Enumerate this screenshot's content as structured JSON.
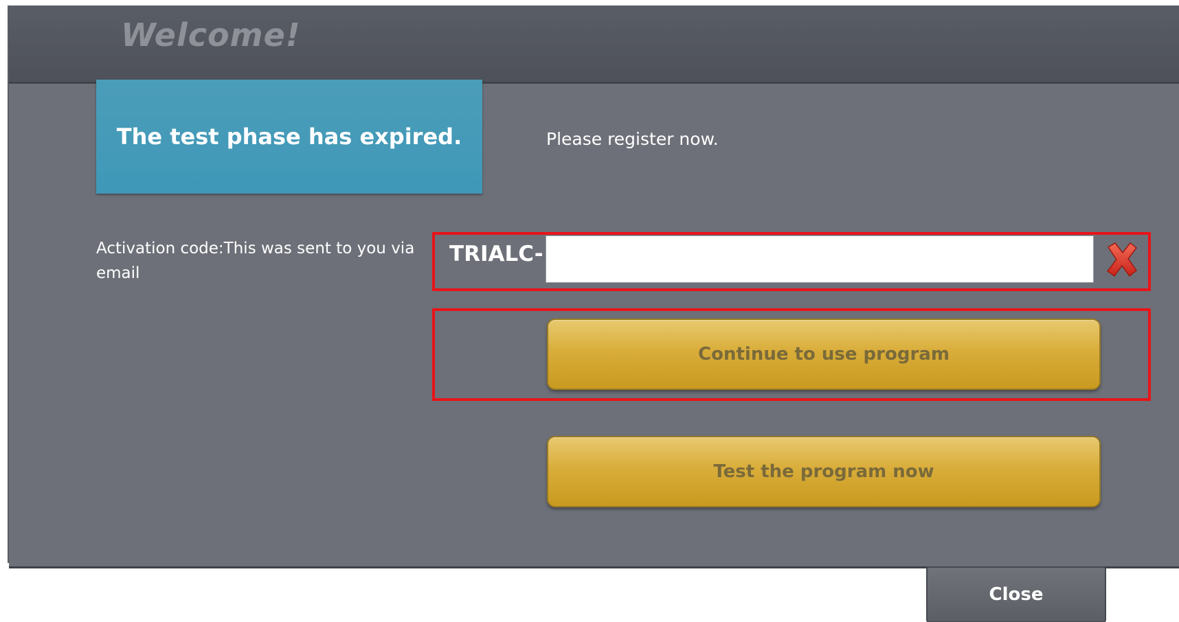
{
  "header": {
    "title": "Welcome!"
  },
  "status": {
    "expired_message": "The test phase has expired.",
    "register_prompt": "Please register now."
  },
  "activation": {
    "label": "Activation code:This was sent to you via email",
    "prefix": "TRIALC-",
    "value": "",
    "placeholder": ""
  },
  "buttons": {
    "continue_label": "Continue to use program",
    "test_label": "Test the program now",
    "close_label": "Close"
  },
  "icons": {
    "clear": "close-x-icon"
  },
  "colors": {
    "accent_blue": "#45a0bf",
    "button_gold": "#d9ad3a",
    "highlight_red": "#e8141a",
    "clear_icon_red": "#e53a2a"
  }
}
